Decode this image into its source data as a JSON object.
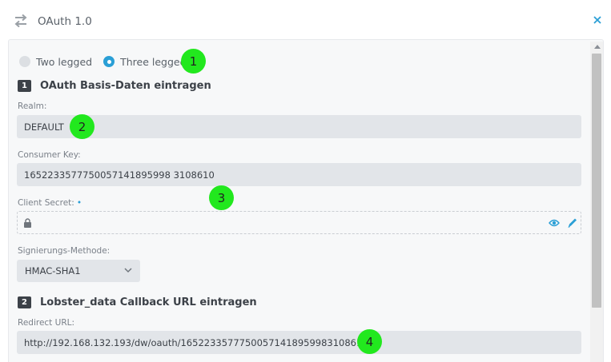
{
  "header": {
    "title": "OAuth 1.0"
  },
  "auth_type": {
    "options": [
      {
        "label": "Two legged",
        "checked": false
      },
      {
        "label": "Three legged",
        "checked": true
      }
    ]
  },
  "markers": [
    "1",
    "2",
    "3",
    "4"
  ],
  "section1": {
    "number": "1",
    "title": "OAuth Basis-Daten eintragen",
    "realm": {
      "label": "Realm:",
      "value": "DEFAULT"
    },
    "consumer_key": {
      "label": "Consumer Key:",
      "value": "1652233577750057141895998 3108610"
    },
    "client_secret": {
      "label": "Client Secret:",
      "required_mark": "•",
      "value": ""
    },
    "signature_method": {
      "label": "Signierungs-Methode:",
      "value": "HMAC-SHA1"
    }
  },
  "section2": {
    "number": "2",
    "title": "Lobster_data Callback URL eintragen",
    "redirect_url": {
      "label": "Redirect URL:",
      "value": "http://192.168.132.193/dw/oauth/16522335777500571418959983108610"
    }
  },
  "colors": {
    "accent": "#2a9fd6",
    "marker": "#22e81e",
    "field_bg": "#e2e5e9"
  }
}
